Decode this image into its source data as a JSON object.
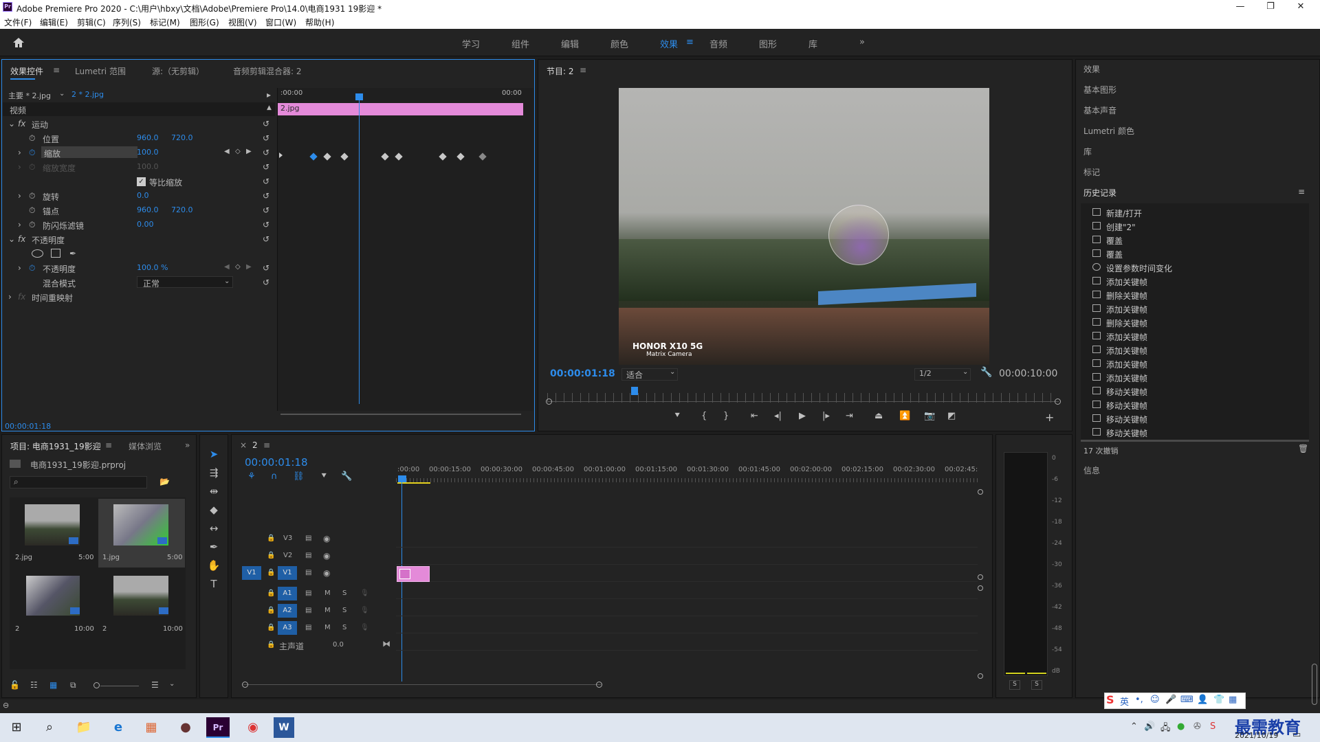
{
  "window": {
    "title": "Adobe Premiere Pro 2020 - C:\\用户\\hbxy\\文档\\Adobe\\Premiere Pro\\14.0\\电商1931  19影迎 *",
    "logo": "Pr",
    "minimize": "—",
    "maximize": "❐",
    "close": "✕"
  },
  "menu": [
    "文件(F)",
    "编辑(E)",
    "剪辑(C)",
    "序列(S)",
    "标记(M)",
    "图形(G)",
    "视图(V)",
    "窗口(W)",
    "帮助(H)"
  ],
  "workspaces": [
    "学习",
    "组件",
    "编辑",
    "颜色",
    "效果",
    "音频",
    "图形",
    "库"
  ],
  "workspace_active": "效果",
  "workspace_more": "»",
  "effect_controls": {
    "tabs": [
      "效果控件",
      "Lumetri 范围",
      "源:（无剪辑）",
      "音频剪辑混合器: 2"
    ],
    "master": "主要 * 2.jpg",
    "clip": "2 * 2.jpg",
    "tc_start": ":00:00",
    "tc_end": "00:00",
    "clip_bar": "2.jpg",
    "section_video": "视频",
    "motion": "运动",
    "position": {
      "label": "位置",
      "x": "960.0",
      "y": "720.0"
    },
    "scale": {
      "label": "缩放",
      "value": "100.0"
    },
    "scale_width": {
      "label": "缩放宽度",
      "value": "100.0"
    },
    "uniform": "等比缩放",
    "rotation": {
      "label": "旋转",
      "value": "0.0"
    },
    "anchor": {
      "label": "锚点",
      "x": "960.0",
      "y": "720.0"
    },
    "flicker": {
      "label": "防闪烁滤镜",
      "value": "0.00"
    },
    "opacity_group": "不透明度",
    "opacity": {
      "label": "不透明度",
      "value": "100.0 %"
    },
    "blend": {
      "label": "混合模式",
      "value": "正常"
    },
    "time_remap": "时间重映射",
    "timecode": "00:00:01:18"
  },
  "program": {
    "title": "节目: 2",
    "timecode": "00:00:01:18",
    "fit": "适合",
    "quality": "1/2",
    "duration": "00:00:10:00",
    "watermark1": "HONOR X10 5G",
    "watermark2": "Matrix Camera"
  },
  "right_panels": [
    "效果",
    "基本图形",
    "基本声音",
    "Lumetri 颜色",
    "库",
    "标记"
  ],
  "history": {
    "title": "历史记录",
    "items": [
      "新建/打开",
      "创建\"2\"",
      "覆盖",
      "覆盖",
      "设置参数时间变化",
      "添加关键帧",
      "删除关键帧",
      "添加关键帧",
      "删除关键帧",
      "添加关键帧",
      "添加关键帧",
      "添加关键帧",
      "添加关键帧",
      "移动关键帧",
      "移动关键帧",
      "移动关键帧",
      "移动关键帧"
    ],
    "undo_count": "17 次撤销",
    "info": "信息"
  },
  "project": {
    "tab1": "项目: 电商1931_19影迎",
    "tab2": "媒体浏览",
    "file": "电商1931_19影迎.prproj",
    "items": [
      {
        "name": "2.jpg",
        "dur": "5:00"
      },
      {
        "name": "1.jpg",
        "dur": "5:00"
      },
      {
        "name": "2",
        "dur": "10:00"
      },
      {
        "name": "2",
        "dur": "10:00"
      }
    ]
  },
  "timeline": {
    "tab": "2",
    "timecode": "00:00:01:18",
    "ruler": [
      ":00:00",
      "00:00:15:00",
      "00:00:30:00",
      "00:00:45:00",
      "00:01:00:00",
      "00:01:15:00",
      "00:01:30:00",
      "00:01:45:00",
      "00:02:00:00",
      "00:02:15:00",
      "00:02:30:00",
      "00:02:45:"
    ],
    "tracks_v": [
      "V3",
      "V2",
      "V1"
    ],
    "tracks_a": [
      "A1",
      "A2",
      "A3"
    ],
    "master": "主声道",
    "master_val": "0.0",
    "src": "V1"
  },
  "meter": {
    "scale": [
      "0",
      "-6",
      "-12",
      "-18",
      "-24",
      "-30",
      "-36",
      "-42",
      "-48",
      "-54",
      "dB"
    ],
    "s1": "S",
    "s2": "S"
  },
  "taskbar": {
    "date": "2021/10/19",
    "ime": "英",
    "brand": "最需教育"
  }
}
